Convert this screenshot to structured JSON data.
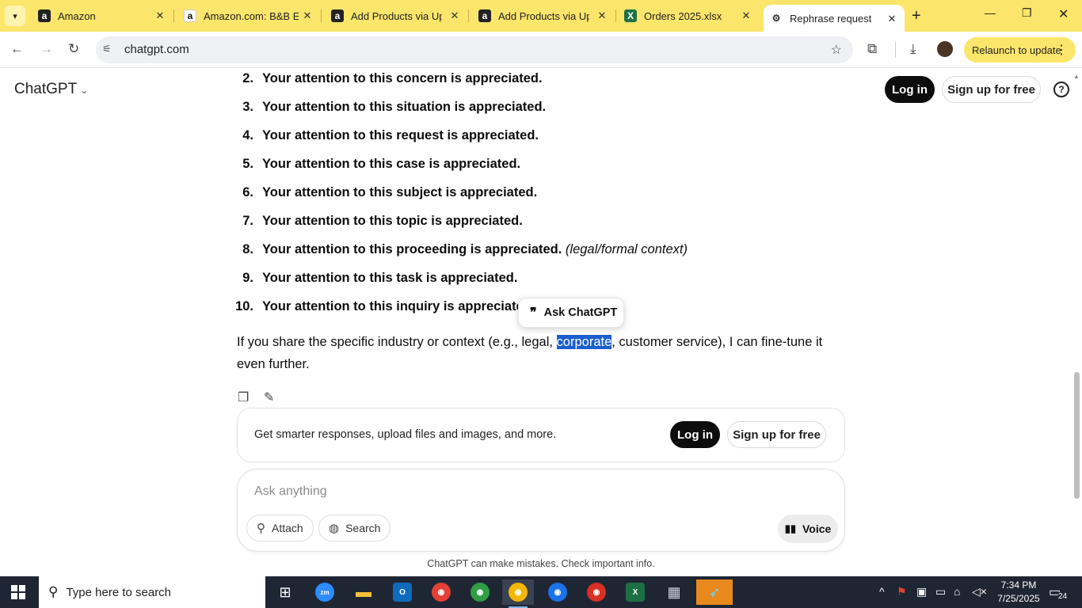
{
  "browser": {
    "tabs": [
      {
        "title": "Amazon",
        "icon": "amazon-icon"
      },
      {
        "title": "Amazon.com: B&B Ele",
        "icon": "amazon-icon"
      },
      {
        "title": "Add Products via Upl",
        "icon": "amazon-icon"
      },
      {
        "title": "Add Products via Upl",
        "icon": "amazon-icon"
      },
      {
        "title": "Orders 2025.xlsx",
        "icon": "excel-icon"
      },
      {
        "title": "Rephrase request",
        "icon": "chatgpt-icon"
      }
    ],
    "url": "chatgpt.com",
    "relaunch_label": "Relaunch to update"
  },
  "header": {
    "brand": "ChatGPT",
    "login_label": "Log in",
    "signup_label": "Sign up for free"
  },
  "list_items": [
    {
      "num": "2.",
      "text": "Your attention to this concern is appreciated.",
      "note": ""
    },
    {
      "num": "3.",
      "text": "Your attention to this situation is appreciated.",
      "note": ""
    },
    {
      "num": "4.",
      "text": "Your attention to this request is appreciated.",
      "note": ""
    },
    {
      "num": "5.",
      "text": "Your attention to this case is appreciated.",
      "note": ""
    },
    {
      "num": "6.",
      "text": "Your attention to this subject is appreciated.",
      "note": ""
    },
    {
      "num": "7.",
      "text": "Your attention to this topic is appreciated.",
      "note": ""
    },
    {
      "num": "8.",
      "text": "Your attention to this proceeding is appreciated.",
      "note": "(legal/formal context)"
    },
    {
      "num": "9.",
      "text": "Your attention to this task is appreciated.",
      "note": ""
    },
    {
      "num": "10.",
      "text": "Your attention to this inquiry is appreciated.",
      "note": ""
    }
  ],
  "ask_popup": {
    "label": "Ask ChatGPT"
  },
  "paragraph": {
    "before": "If you share the specific industry or context (e.g., legal, ",
    "selected": "corporate",
    "after": ", customer service), I can fine-tune it even further."
  },
  "signup_card": {
    "message": "Get smarter responses, upload files and images, and more.",
    "login_label": "Log in",
    "signup_label": "Sign up for free"
  },
  "composer": {
    "placeholder": "Ask anything",
    "attach_label": "Attach",
    "search_label": "Search",
    "voice_label": "Voice"
  },
  "disclaimer": "ChatGPT can make mistakes. Check important info.",
  "taskbar": {
    "search_placeholder": "Type here to search",
    "time": "7:34 PM",
    "date": "7/25/2025",
    "notification_count": "24"
  },
  "colors": {
    "tab_bar": "#fce56b",
    "selection": "#1a5fd0",
    "taskbar": "#1f2633"
  }
}
